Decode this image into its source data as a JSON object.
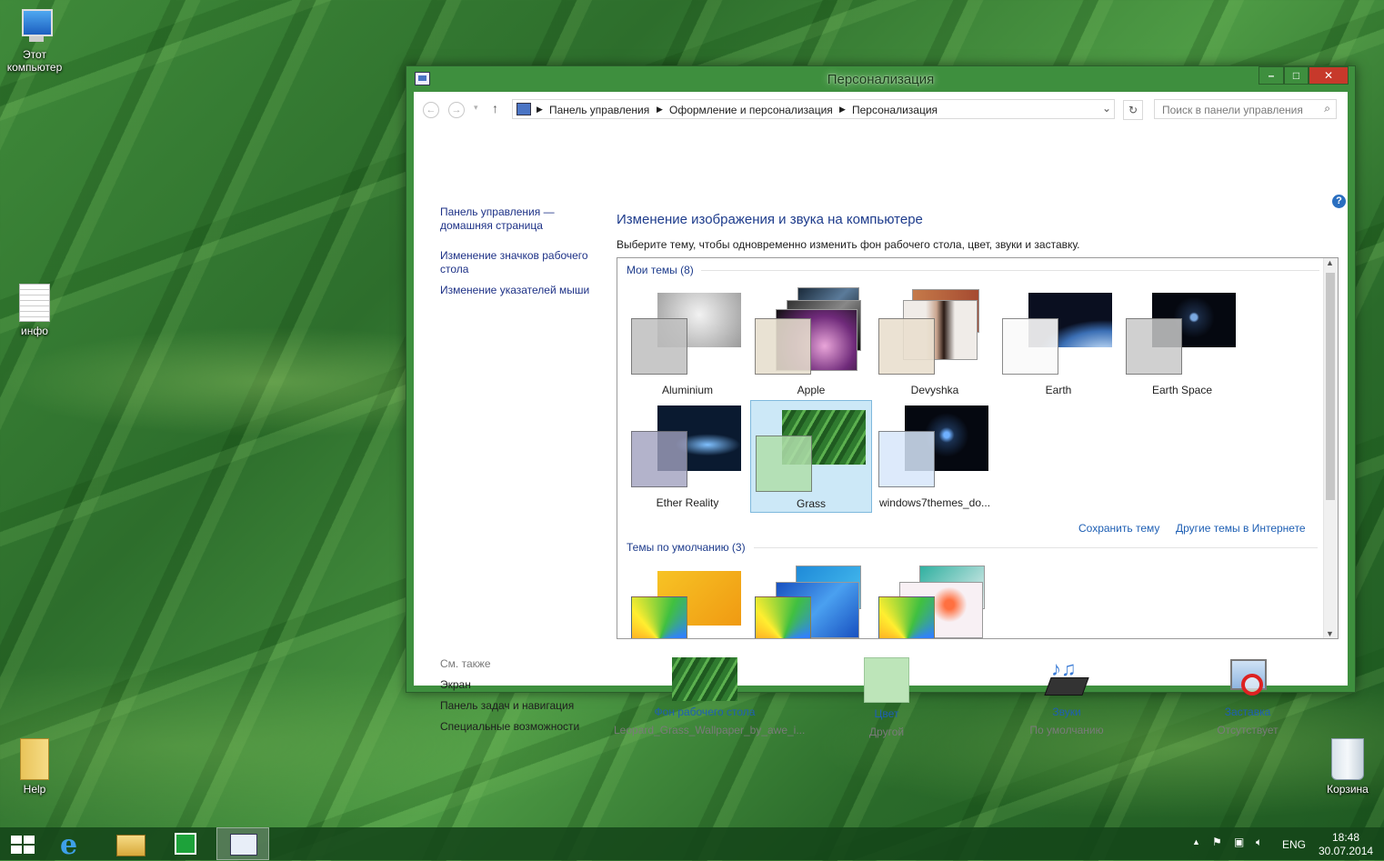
{
  "desktop": {
    "icons": [
      {
        "label": "Этот компьютер",
        "icon": "this-pc-icon"
      },
      {
        "label": "инфо",
        "icon": "text-file-icon"
      },
      {
        "label": "Help",
        "icon": "folder-icon"
      },
      {
        "label": "Корзина",
        "icon": "recycle-bin-icon"
      }
    ]
  },
  "window": {
    "title": "Персонализация",
    "controls": {
      "minimize": "–",
      "maximize": "□",
      "close": "✕"
    },
    "breadcrumb": [
      "Панель управления",
      "Оформление и персонализация",
      "Персонализация"
    ],
    "search_placeholder": "Поиск в панели управления",
    "help": "?"
  },
  "sidebar": {
    "home_link": "Панель управления — домашняя страница",
    "links": [
      "Изменение значков рабочего стола",
      "Изменение указателей мыши"
    ],
    "see_also_title": "См. также",
    "see_also": [
      "Экран",
      "Панель задач и навигация",
      "Специальные возможности"
    ]
  },
  "main": {
    "title": "Изменение изображения и звука на компьютере",
    "description": "Выберите тему, чтобы одновременно изменить фон рабочего стола, цвет, звуки и заставку.",
    "my_themes_header": "Мои темы (8)",
    "my_themes": [
      "Aluminium",
      "Apple",
      "Devyshka",
      "Earth",
      "Earth Space",
      "Ether Reality",
      "Grass",
      "windows7themes_do..."
    ],
    "selected_theme": "Grass",
    "save_theme": "Сохранить тему",
    "more_themes": "Другие темы в Интернете",
    "default_themes_header": "Темы по умолчанию (3)"
  },
  "bottom": {
    "items": [
      {
        "label": "Фон рабочего стола",
        "sub": "Leopard_Grass_Wallpaper_by_awe_i..."
      },
      {
        "label": "Цвет",
        "sub": "Другой"
      },
      {
        "label": "Звуки",
        "sub": "По умолчанию"
      },
      {
        "label": "Заставка",
        "sub": "Отсутствует"
      }
    ]
  },
  "taskbar": {
    "apps": [
      "start-icon",
      "internet-explorer-icon",
      "file-explorer-icon",
      "store-icon",
      "control-panel-icon"
    ],
    "tray": {
      "lang": "ENG",
      "time": "18:48",
      "date": "30.07.2014"
    }
  },
  "colors": {
    "accent": "#3e8f3e",
    "link": "#1e3287",
    "heading": "#1e3c8c",
    "selection": "#cce8f7"
  }
}
